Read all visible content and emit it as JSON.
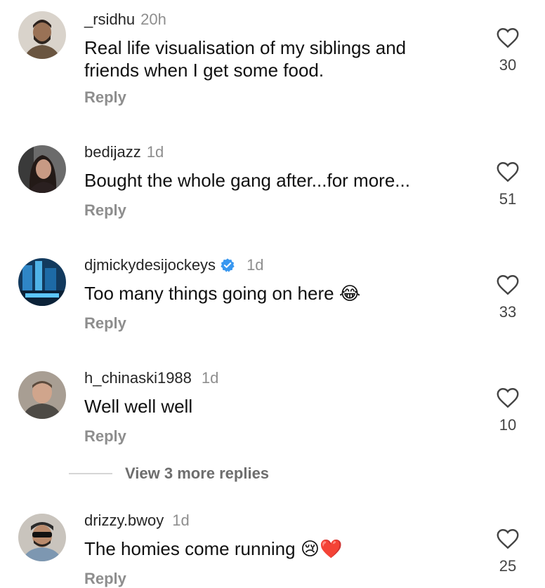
{
  "comments": [
    {
      "username": "_rsidhu",
      "time": "20h",
      "text_lines": [
        "Real life visualisation of my siblings and",
        "friends when I get some food."
      ],
      "reply": "Reply",
      "likes": "30",
      "verified": false
    },
    {
      "username": "bedijazz",
      "time": "1d",
      "text_lines": [
        "Bought the whole gang after...for more..."
      ],
      "reply": "Reply",
      "likes": "51",
      "verified": false
    },
    {
      "username": "djmickydesijockeys",
      "time": "1d",
      "text_lines": [
        "Too many things going on here"
      ],
      "emoji": "😂",
      "reply": "Reply",
      "likes": "33",
      "verified": true
    },
    {
      "username": "h_chinaski1988",
      "time": "1d",
      "text_lines": [
        "Well well well"
      ],
      "reply": "Reply",
      "likes": "10",
      "verified": false
    },
    {
      "username": "drizzy.bwoy",
      "time": "1d",
      "text_lines": [
        "The homies come running"
      ],
      "emoji": "😢❤️",
      "reply": "Reply",
      "likes": "25",
      "verified": false
    }
  ],
  "view_more_replies": "View 3 more replies",
  "colors": {
    "verified_blue": "#3897f0",
    "muted": "#8e8e8e"
  },
  "icons": {
    "like": "heart-outline-icon",
    "verified": "verified-badge-icon"
  }
}
